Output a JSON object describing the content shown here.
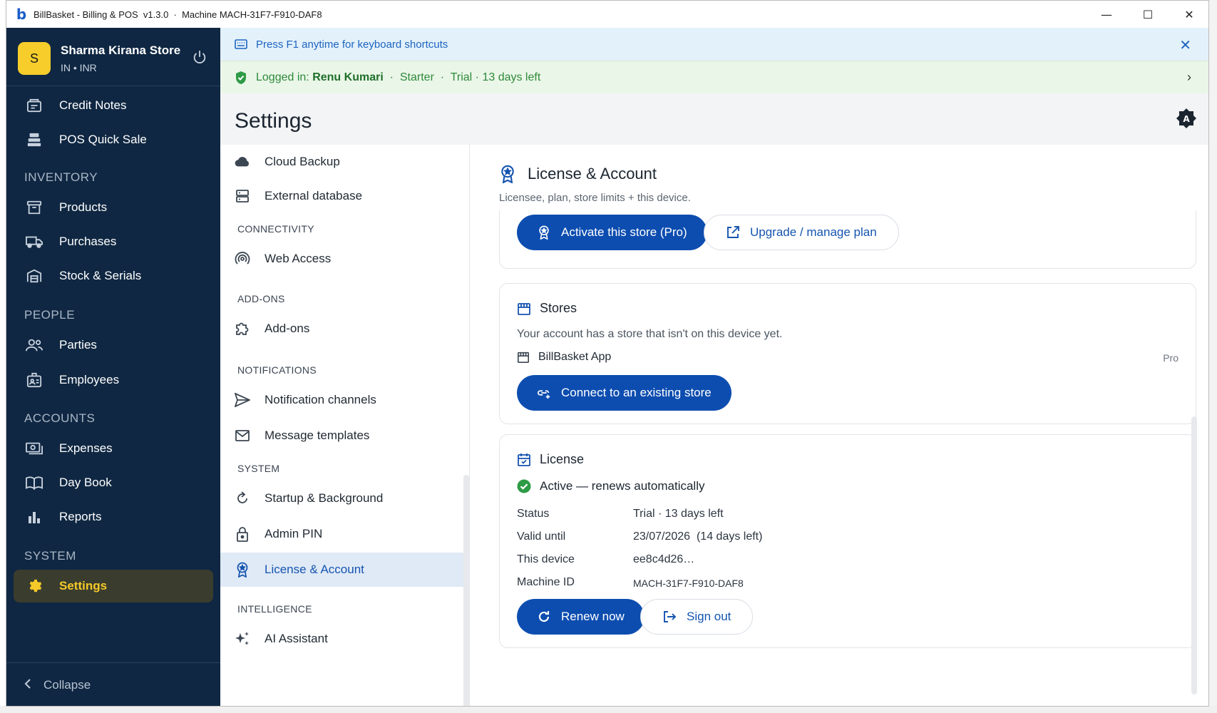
{
  "window": {
    "title": "BillBasket - Billing & POS  v1.3.0  ·  Machine MACH-31F7-F910-DAF8",
    "logo_letter": "b",
    "minimize": "—",
    "maximize": "☐",
    "close": "✕"
  },
  "store": {
    "avatar": "S",
    "name": "Sharma Kirana Store",
    "sub": "IN • INR"
  },
  "sidebar": {
    "items": [
      {
        "label": "Credit Notes"
      },
      {
        "label": "POS Quick Sale"
      },
      {
        "label": "Products"
      },
      {
        "label": "Purchases"
      },
      {
        "label": "Stock & Serials"
      },
      {
        "label": "Parties"
      },
      {
        "label": "Employees"
      },
      {
        "label": "Expenses"
      },
      {
        "label": "Day Book"
      },
      {
        "label": "Reports"
      },
      {
        "label": "Settings"
      }
    ],
    "sections": {
      "inventory": "INVENTORY",
      "people": "PEOPLE",
      "accounts": "ACCOUNTS",
      "system": "SYSTEM"
    },
    "collapse": "Collapse"
  },
  "banners": {
    "shortcuts": "Press F1 anytime for keyboard shortcuts",
    "logged_prefix": "Logged in: ",
    "user": "Renu Kumari",
    "plan_info": "  ·  Starter  ·  Trial · 13 days left"
  },
  "settings": {
    "title": "Settings",
    "menu": {
      "cloud_backup": "Cloud Backup",
      "external_db": "External database",
      "sec_connectivity": "CONNECTIVITY",
      "web_access": "Web Access",
      "sec_addons": "ADD-ONS",
      "addons": "Add-ons",
      "sec_notifications": "NOTIFICATIONS",
      "notification_channels": "Notification channels",
      "message_templates": "Message templates",
      "sec_system": "SYSTEM",
      "startup": "Startup & Background",
      "admin_pin": "Admin PIN",
      "license": "License & Account",
      "sec_intelligence": "INTELLIGENCE",
      "ai_assistant": "AI Assistant"
    }
  },
  "content": {
    "title": "License & Account",
    "subtitle": "Licensee, plan, store limits + this device.",
    "activate_btn": "Activate this store (Pro)",
    "upgrade_btn": "Upgrade / manage plan",
    "stores": {
      "title": "Stores",
      "text": "Your account has a store that isn't on this device yet.",
      "store_name": "BillBasket App",
      "store_plan": "Pro",
      "connect_btn": "Connect to an existing store"
    },
    "license": {
      "title": "License",
      "status_line": "Active — renews automatically",
      "rows": [
        {
          "label": "Status",
          "value": "Trial · 13 days left"
        },
        {
          "label": "Valid until",
          "value": "23/07/2026  (14 days left)"
        },
        {
          "label": "This device",
          "value": "ee8c4d26…"
        },
        {
          "label": "Machine ID",
          "value": "MACH-31F7-F910-DAF8"
        }
      ],
      "renew_btn": "Renew now",
      "signout_btn": "Sign out"
    }
  },
  "colors": {
    "sidebar_bg": "#0f2742",
    "accent": "#0d4db0",
    "active_yellow": "#f5c928",
    "success": "#2e9b46"
  }
}
